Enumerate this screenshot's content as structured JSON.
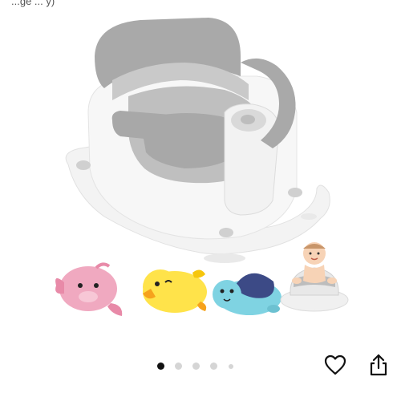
{
  "header": {
    "partial_text": "...ge ... y)"
  },
  "gallery": {
    "image_icon": "baby-bath-seat-product-image",
    "image_count": 5,
    "active_index": 0,
    "colors": {
      "seat_gray": "#a9a9a9",
      "seat_white": "#f2f2f2",
      "toy_pink": "#f0a9c0",
      "toy_yellow": "#ffe34a",
      "toy_blue": "#7fd3e2",
      "toy_navy": "#3c4a86"
    }
  },
  "actions": {
    "favorite_icon": "heart-outline-icon",
    "share_icon": "share-icon"
  }
}
